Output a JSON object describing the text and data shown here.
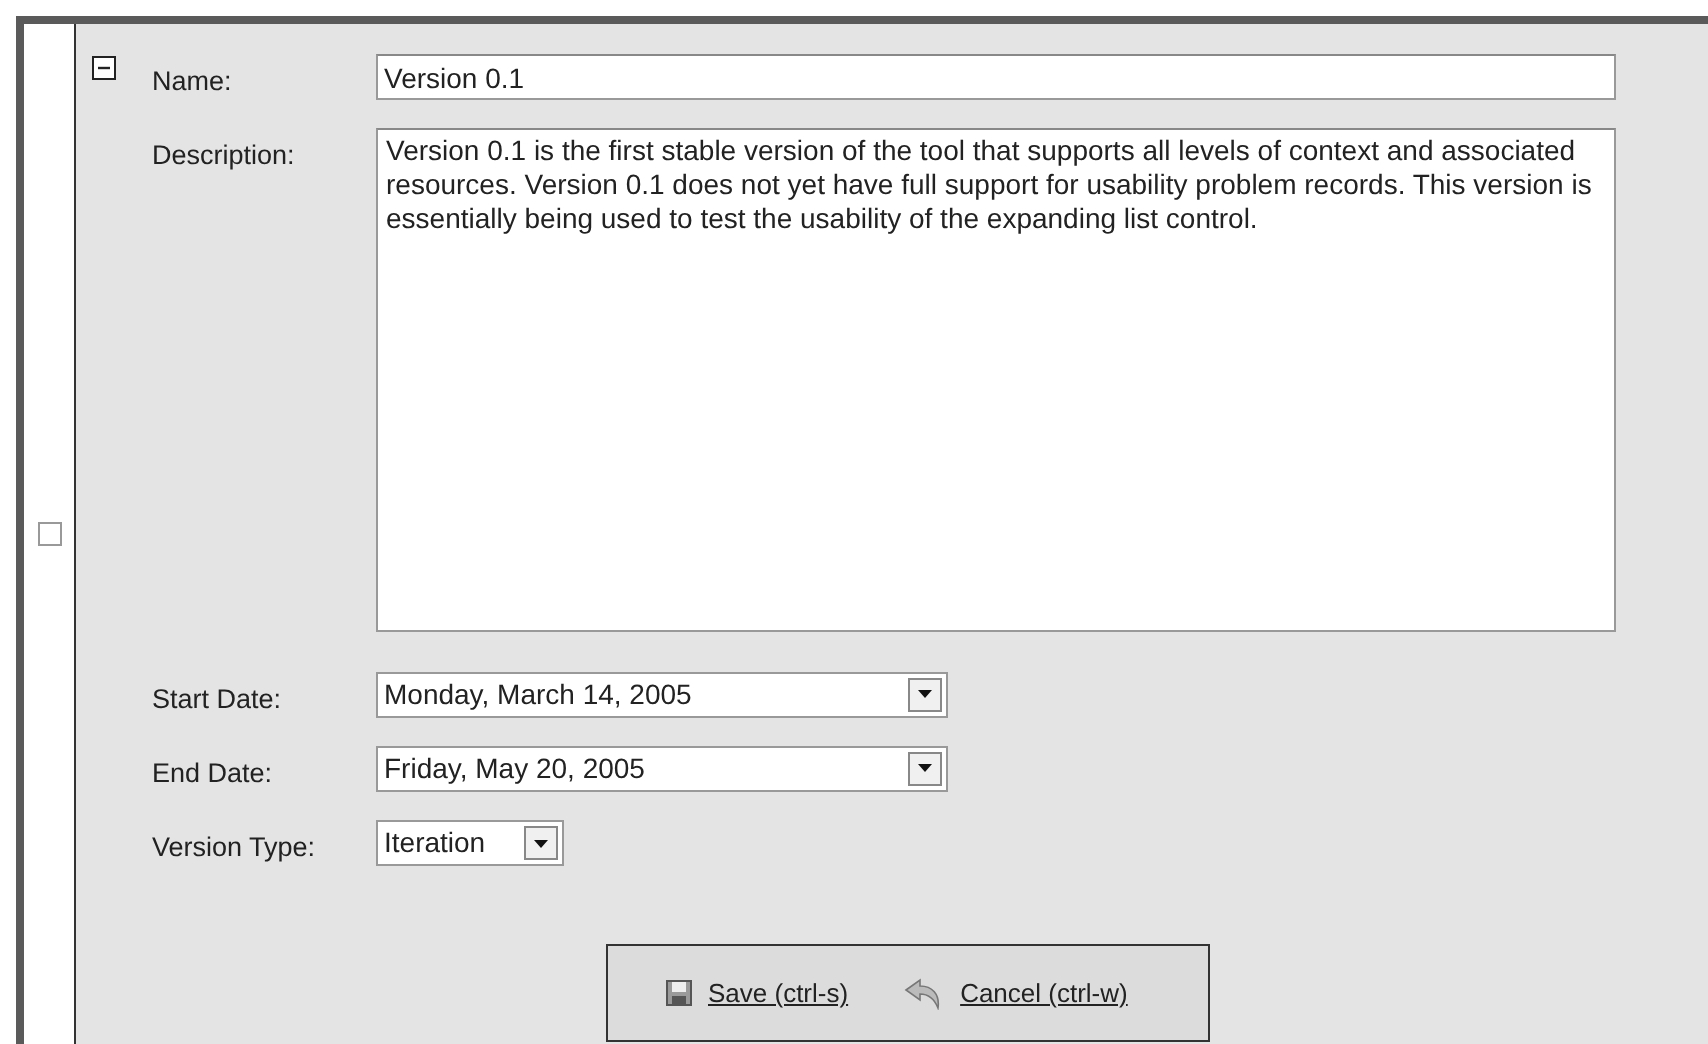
{
  "row": {
    "checked": false,
    "expanded": true
  },
  "fields": [
    {
      "kind": "text",
      "label": "Name:",
      "value": "Version 0.1"
    },
    {
      "kind": "textarea",
      "label": "Description:",
      "value": "Version 0.1 is the first stable version of the tool that supports all levels of context and associated resources. Version 0.1 does not yet have full support for usability problem records. This version is essentially being used to test the usability of the expanding list control."
    },
    {
      "kind": "date",
      "label": "Start Date:",
      "value": "Monday, March 14, 2005"
    },
    {
      "kind": "date",
      "label": "End Date:",
      "value": "Friday, May 20, 2005"
    },
    {
      "kind": "select",
      "label": "Version Type:",
      "value": "Iteration"
    }
  ],
  "actions": [
    {
      "kind": "save",
      "label": "Save (ctrl-s)"
    },
    {
      "kind": "cancel",
      "label": "Cancel (ctrl-w)"
    }
  ]
}
